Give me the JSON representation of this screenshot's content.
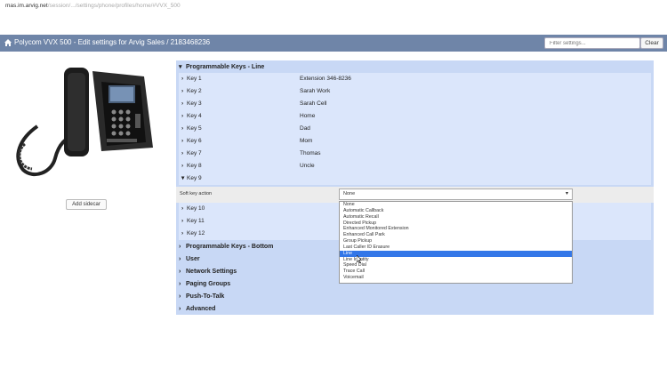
{
  "browser": {
    "url_host": "mas.im.arvig.net",
    "url_path": "/session/.../settings/phone/profiles/home/#VVX_500"
  },
  "header": {
    "title": "Polycom VVX 500 - Edit settings for Arvig  Sales / 2183468236",
    "filter_placeholder": "Filter settings...",
    "clear_label": "Clear"
  },
  "sidebar": {
    "add_sidecar_label": "Add sidecar"
  },
  "sections": {
    "programmable_keys_line": "Programmable Keys - Line",
    "programmable_keys_bottom": "Programmable Keys - Bottom",
    "user": "User",
    "network_settings": "Network Settings",
    "paging_groups": "Paging Groups",
    "push_to_talk": "Push-To-Talk",
    "advanced": "Advanced"
  },
  "keys": [
    {
      "label": "Key 1",
      "value": "Extension 346-8236"
    },
    {
      "label": "Key 2",
      "value": "Sarah Work"
    },
    {
      "label": "Key 3",
      "value": "Sarah Cell"
    },
    {
      "label": "Key 4",
      "value": "Home"
    },
    {
      "label": "Key 5",
      "value": "Dad"
    },
    {
      "label": "Key 6",
      "value": "Mom"
    },
    {
      "label": "Key 7",
      "value": "Thomas"
    },
    {
      "label": "Key 8",
      "value": "Uncle"
    },
    {
      "label": "Key 9",
      "value": ""
    },
    {
      "label": "Key 10",
      "value": ""
    },
    {
      "label": "Key 11",
      "value": ""
    },
    {
      "label": "Key 12",
      "value": ""
    }
  ],
  "softkey": {
    "label": "Soft key action",
    "selected": "None",
    "options": [
      "None",
      "Automatic Callback",
      "Automatic Recall",
      "Directed Pickup",
      "Enhanced Monitored Extension",
      "Enhanced Call Park",
      "Group Pickup",
      "Last Caller ID Erasure",
      "Line",
      "Line Identity",
      "Speed Dial",
      "Trace Call",
      "Voicemail"
    ],
    "highlighted": "Line"
  },
  "colors": {
    "header_bg": "#6f85a8",
    "panel_bg": "#c8d8f5",
    "row_bg": "#dbe6fb",
    "highlight": "#3377e8"
  }
}
